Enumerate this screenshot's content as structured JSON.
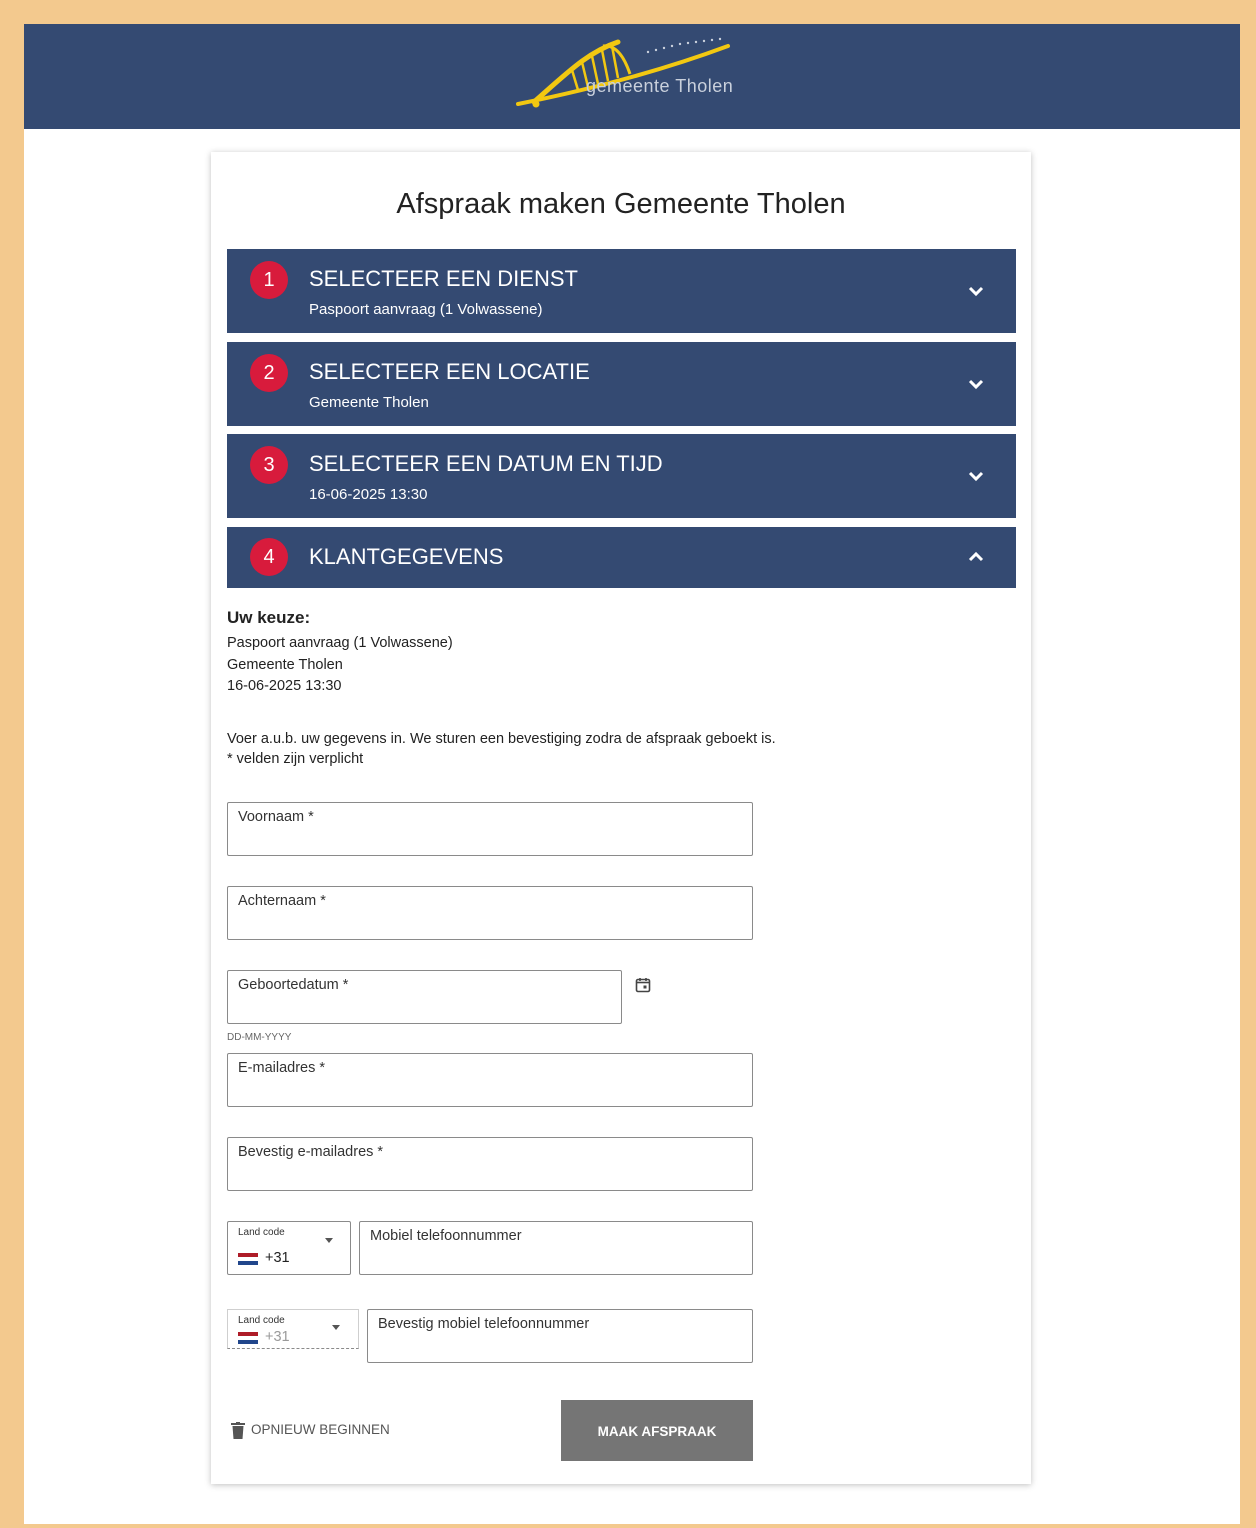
{
  "header": {
    "logo_text": "gemeente Tholen"
  },
  "page": {
    "title": "Afspraak maken Gemeente Tholen"
  },
  "steps": [
    {
      "number": "1",
      "title": "SELECTEER EEN DIENST",
      "subtitle": "Paspoort aanvraag (1 Volwassene)",
      "state": "collapsed"
    },
    {
      "number": "2",
      "title": "SELECTEER EEN LOCATIE",
      "subtitle": "Gemeente Tholen",
      "state": "collapsed"
    },
    {
      "number": "3",
      "title": "SELECTEER EEN DATUM EN TIJD",
      "subtitle": "16-06-2025 13:30",
      "state": "collapsed"
    },
    {
      "number": "4",
      "title": "KLANTGEGEVENS",
      "subtitle": "",
      "state": "expanded"
    }
  ],
  "summary": {
    "heading": "Uw keuze:",
    "service": "Paspoort aanvraag (1 Volwassene)",
    "location": "Gemeente Tholen",
    "datetime": "16-06-2025 13:30"
  },
  "instructions": {
    "text": "Voer a.u.b. uw gegevens in. We sturen een bevestiging zodra de afspraak geboekt is.",
    "required_note": "* velden zijn verplicht"
  },
  "form": {
    "first_name_label": "Voornaam *",
    "last_name_label": "Achternaam *",
    "birthdate_label": "Geboortedatum *",
    "birthdate_hint": "DD-MM-YYYY",
    "email_label": "E-mailadres *",
    "email_confirm_label": "Bevestig e-mailadres *",
    "country_code_label": "Land code",
    "country_code_value": "+31",
    "mobile_label": "Mobiel telefoonnummer",
    "country_code_confirm_label": "Land code",
    "country_code_confirm_value": "+31",
    "mobile_confirm_label": "Bevestig mobiel telefoonnummer"
  },
  "actions": {
    "reset_label": "OPNIEUW BEGINNEN",
    "submit_label": "MAAK AFSPRAAK"
  },
  "colors": {
    "brand_navy": "#344a72",
    "step_badge_red": "#d81b3c",
    "logo_yellow": "#f2c811",
    "page_border": "#f3c98e",
    "submit_gray": "#757575"
  },
  "icons": {
    "collapsed_chevron": "chevron-down-icon",
    "expanded_chevron": "chevron-up-icon",
    "calendar": "calendar-icon",
    "reset": "trash-icon",
    "flag": "netherlands-flag-icon"
  }
}
